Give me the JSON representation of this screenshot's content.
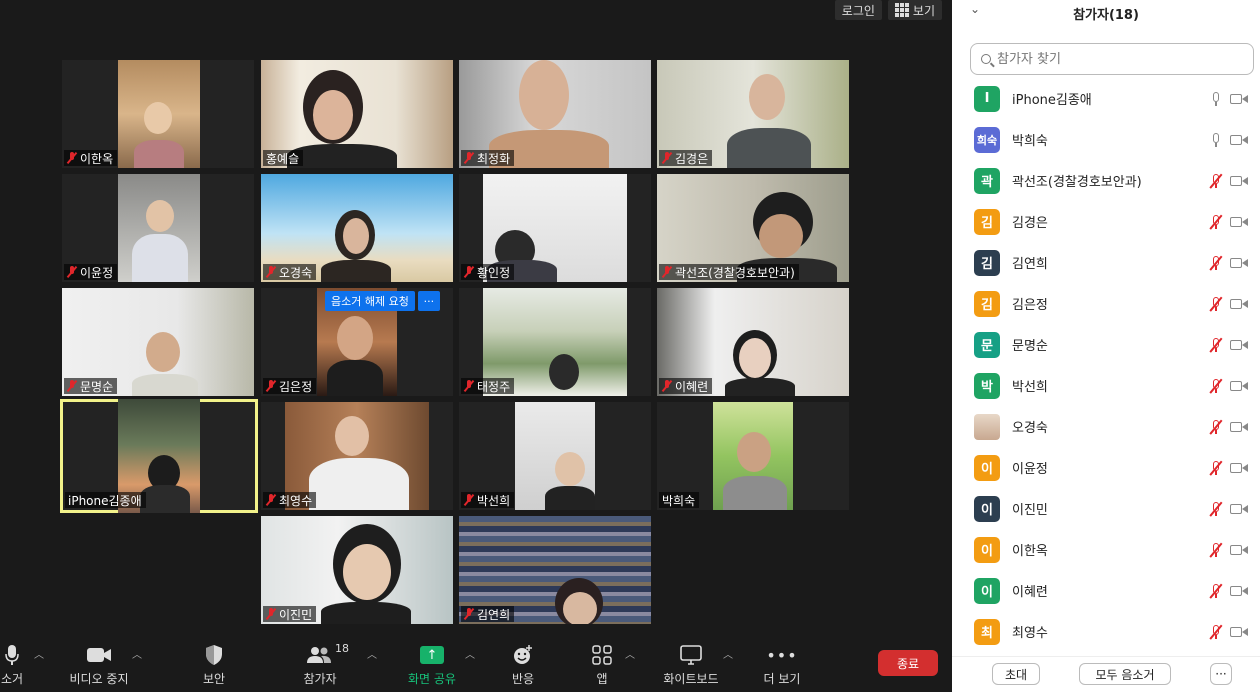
{
  "top_bar": {
    "login_label": "로그인",
    "view_label": "보기"
  },
  "tiles": [
    {
      "name": "이한옥",
      "muted": true
    },
    {
      "name": "홍예슬",
      "muted": false
    },
    {
      "name": "최정화",
      "muted": true
    },
    {
      "name": "김경은",
      "muted": true
    },
    {
      "name": "이윤정",
      "muted": true
    },
    {
      "name": "오경숙",
      "muted": true
    },
    {
      "name": "황인정",
      "muted": true
    },
    {
      "name": "곽선조(경찰경호보안과)",
      "muted": true
    },
    {
      "name": "문명순",
      "muted": true
    },
    {
      "name": "김은정",
      "muted": true
    },
    {
      "name": "태정주",
      "muted": true
    },
    {
      "name": "이혜련",
      "muted": true
    },
    {
      "name": "iPhone김종애",
      "muted": false
    },
    {
      "name": "최영수",
      "muted": true
    },
    {
      "name": "박선희",
      "muted": true
    },
    {
      "name": "박희숙",
      "muted": false
    },
    {
      "name": "이진민",
      "muted": true
    },
    {
      "name": "김연희",
      "muted": true
    }
  ],
  "unmute_request": {
    "label": "음소거 해제 요청",
    "more": "···"
  },
  "toolbar": {
    "mute_label": "소거",
    "video_label": "비디오 중지",
    "security_label": "보안",
    "participants_label": "참가자",
    "participants_count": "18",
    "share_label": "화면 공유",
    "reactions_label": "반응",
    "apps_label": "앱",
    "whiteboard_label": "화이트보드",
    "more_label": "더 보기",
    "end_label": "종료"
  },
  "panel": {
    "title": "참가자(18)",
    "search_placeholder": "참가자 찾기",
    "participants": [
      {
        "initial": "I",
        "name": "iPhone김종애",
        "color": "#1fa463",
        "muted": false
      },
      {
        "initial": "희숙",
        "name": "박희숙",
        "color": "#5b6bd5",
        "muted": false
      },
      {
        "initial": "곽",
        "name": "곽선조(경찰경호보안과)",
        "color": "#1fa463",
        "muted": true
      },
      {
        "initial": "김",
        "name": "김경은",
        "color": "#f39c12",
        "muted": true
      },
      {
        "initial": "김",
        "name": "김연희",
        "color": "#2c3e50",
        "muted": true
      },
      {
        "initial": "김",
        "name": "김은정",
        "color": "#f39c12",
        "muted": true
      },
      {
        "initial": "문",
        "name": "문명순",
        "color": "#16a085",
        "muted": true
      },
      {
        "initial": "박",
        "name": "박선희",
        "color": "#1fa463",
        "muted": true
      },
      {
        "initial": "",
        "name": "오경숙",
        "color": "#d8c4b0",
        "muted": true
      },
      {
        "initial": "이",
        "name": "이윤정",
        "color": "#f39c12",
        "muted": true
      },
      {
        "initial": "이",
        "name": "이진민",
        "color": "#2c3e50",
        "muted": true
      },
      {
        "initial": "이",
        "name": "이한옥",
        "color": "#f39c12",
        "muted": true
      },
      {
        "initial": "이",
        "name": "이혜련",
        "color": "#1fa463",
        "muted": true
      },
      {
        "initial": "최",
        "name": "최영수",
        "color": "#f39c12",
        "muted": true
      }
    ],
    "invite_label": "초대",
    "mute_all_label": "모두 음소거",
    "more_label": "···"
  }
}
